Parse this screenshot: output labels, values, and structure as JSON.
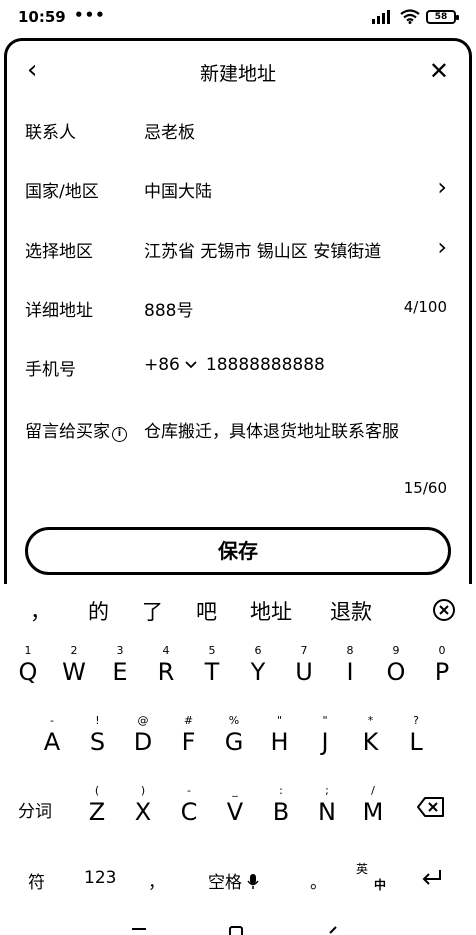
{
  "status": {
    "time": "10:59",
    "dots": "•••",
    "battery": "58"
  },
  "header": {
    "title": "新建地址",
    "back_icon": "‹",
    "close_icon": "✕"
  },
  "form": {
    "contact": {
      "label": "联系人",
      "value": "忌老板"
    },
    "country": {
      "label": "国家/地区",
      "value": "中国大陆"
    },
    "region": {
      "label": "选择地区",
      "value": "江苏省 无锡市 锡山区 安镇街道"
    },
    "address": {
      "label": "详细地址",
      "value": "888号",
      "count": "4/100"
    },
    "phone": {
      "label": "手机号",
      "prefix": "+86",
      "value": "18888888888"
    },
    "message": {
      "label": "留言给买家",
      "value": "仓库搬迁，具体退货地址联系客服",
      "count": "15/60"
    }
  },
  "save_label": "保存",
  "keyboard": {
    "candidates": [
      "，",
      "的",
      "了",
      "吧",
      "地址",
      "退款"
    ],
    "row1": [
      {
        "k": "Q",
        "h": "1"
      },
      {
        "k": "W",
        "h": "2"
      },
      {
        "k": "E",
        "h": "3"
      },
      {
        "k": "R",
        "h": "4"
      },
      {
        "k": "T",
        "h": "5"
      },
      {
        "k": "Y",
        "h": "6"
      },
      {
        "k": "U",
        "h": "7"
      },
      {
        "k": "I",
        "h": "8"
      },
      {
        "k": "O",
        "h": "9"
      },
      {
        "k": "P",
        "h": "0"
      }
    ],
    "row2": [
      {
        "k": "A",
        "h": "-"
      },
      {
        "k": "S",
        "h": "!"
      },
      {
        "k": "D",
        "h": "@"
      },
      {
        "k": "F",
        "h": "#"
      },
      {
        "k": "G",
        "h": "%"
      },
      {
        "k": "H",
        "h": "\""
      },
      {
        "k": "J",
        "h": "\""
      },
      {
        "k": "K",
        "h": "*"
      },
      {
        "k": "L",
        "h": "?"
      }
    ],
    "row3": [
      {
        "k": "Z",
        "h": "("
      },
      {
        "k": "X",
        "h": ")"
      },
      {
        "k": "C",
        "h": "-"
      },
      {
        "k": "V",
        "h": "_"
      },
      {
        "k": "B",
        "h": ":"
      },
      {
        "k": "N",
        "h": ";"
      },
      {
        "k": "M",
        "h": "/"
      }
    ],
    "fenci": "分词",
    "fu": "符",
    "num": "123",
    "comma": "，",
    "space": "空格",
    "period": "。",
    "lang_top": "英",
    "lang_bottom": "中"
  }
}
